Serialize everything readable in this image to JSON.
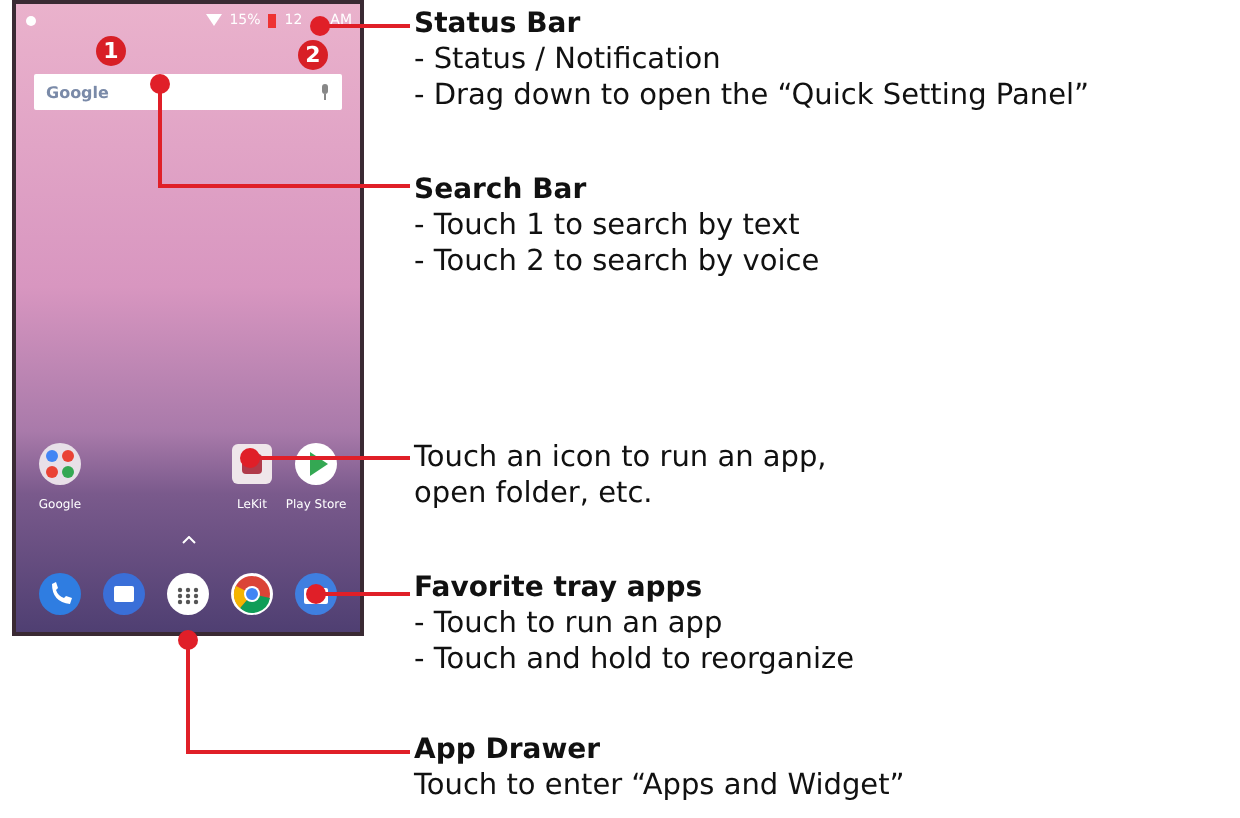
{
  "status_bar": {
    "battery": "15%",
    "time_parts": [
      "12",
      "AM"
    ]
  },
  "search_bar": {
    "logo": "Google",
    "markers": [
      "1",
      "2"
    ]
  },
  "home_apps": [
    {
      "label": "Google",
      "kind": "folder"
    },
    {
      "label": "LeKit",
      "kind": "app"
    },
    {
      "label": "Play Store",
      "kind": "store"
    }
  ],
  "dock": [
    {
      "kind": "phone"
    },
    {
      "kind": "messages"
    },
    {
      "kind": "drawer"
    },
    {
      "kind": "browser"
    },
    {
      "kind": "camera"
    }
  ],
  "callouts": [
    {
      "title": "Status Bar",
      "lines": [
        "- Status / Notification",
        "- Drag down to open the “Quick Setting Panel”"
      ]
    },
    {
      "title": "Search Bar",
      "lines": [
        "- Touch 1 to search by text",
        "- Touch 2 to search by voice"
      ]
    },
    {
      "lines": [
        "Touch an icon to run an app,",
        "open folder, etc."
      ]
    },
    {
      "title": "Favorite tray apps",
      "lines": [
        "- Touch to run an app",
        "- Touch and hold to reorganize"
      ]
    },
    {
      "title": "App Drawer",
      "lines": [
        "Touch to enter “Apps and Widget”"
      ]
    }
  ]
}
